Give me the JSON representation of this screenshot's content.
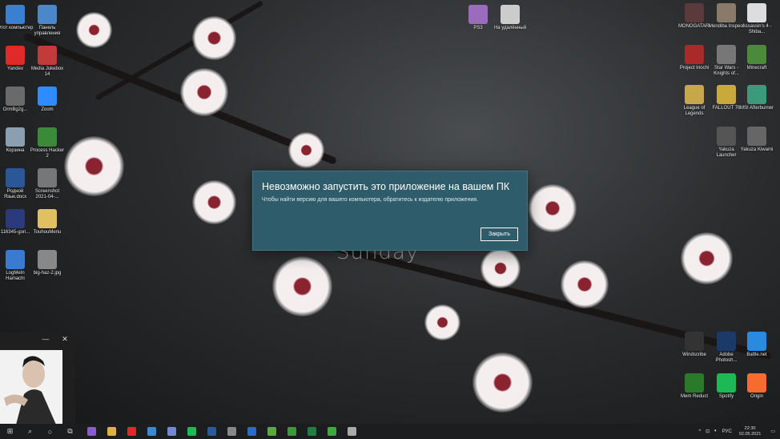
{
  "wallpaper": {
    "clock_text": "Sunday"
  },
  "desktop_icons_left": [
    {
      "label": "Этот компьютер",
      "icon": "computer-icon",
      "color": "#3b7fd1"
    },
    {
      "label": "Панель управления",
      "icon": "control-panel-icon",
      "color": "#4b88c9"
    },
    {
      "label": "Yandex",
      "icon": "yandex-browser-icon",
      "color": "#e02a2a"
    },
    {
      "label": "Media Jukebox 14",
      "icon": "media-jukebox-icon",
      "color": "#c23a3a"
    },
    {
      "label": "OrmBg2g...",
      "icon": "ormbg-icon",
      "color": "#6a6a6a"
    },
    {
      "label": "Zoom",
      "icon": "zoom-icon",
      "color": "#2d8cff"
    },
    {
      "label": "Корзина",
      "icon": "recycle-bin-icon",
      "color": "#8aa0b0"
    },
    {
      "label": "Process Hacker 2",
      "icon": "process-hacker-icon",
      "color": "#3a8a3a"
    },
    {
      "label": "Родной Язык.docx",
      "icon": "word-doc-icon",
      "color": "#2b5797"
    },
    {
      "label": "Screenshot 2021-04-...",
      "icon": "screenshot-file-icon",
      "color": "#777777"
    },
    {
      "label": "116345-gon...",
      "icon": "image-file-icon",
      "color": "#2a3a7a"
    },
    {
      "label": "TouhouMenu",
      "icon": "folder-icon",
      "color": "#e0c060"
    },
    {
      "label": "LogMeIn Hamachi",
      "icon": "hamachi-icon",
      "color": "#3a7ad0"
    },
    {
      "label": "big-haz-2.jpg",
      "icon": "jpg-file-icon",
      "color": "#888888"
    }
  ],
  "desktop_icons_top_center": [
    {
      "label": "PS3",
      "icon": "ps3-shortcut-icon",
      "color": "#9b6bc0"
    },
    {
      "label": "На удалённый",
      "icon": "text-file-icon",
      "color": "#cccccc"
    }
  ],
  "desktop_icons_right": [
    {
      "label": "MONOGATARI",
      "icon": "game-icon-1",
      "color": "#5a3a3a"
    },
    {
      "label": "Mendiba Inspect",
      "icon": "game-icon-2",
      "color": "#8a7a6a"
    },
    {
      "label": "Assassin's 4 - Shiba...",
      "icon": "game-icon-3",
      "color": "#ddd"
    },
    {
      "label": "Project Inochi",
      "icon": "game-icon-4",
      "color": "#aa2a2a"
    },
    {
      "label": "Star Wars - Knights of...",
      "icon": "star-wars-icon",
      "color": "#777"
    },
    {
      "label": "Minecraft",
      "icon": "minecraft-icon",
      "color": "#4a8a3a"
    },
    {
      "label": "League of Legends",
      "icon": "league-icon",
      "color": "#c8a74a"
    },
    {
      "label": "FALLOUT 76",
      "icon": "fallout-icon",
      "color": "#c9a93a"
    },
    {
      "label": "MSI Afterburner",
      "icon": "msi-icon",
      "color": "#3a9a7a"
    },
    {
      "label": "Yakuza Launcher",
      "icon": "yakuza-launcher-icon",
      "color": "#555"
    },
    {
      "label": "Yakuza Kiwami",
      "icon": "yakuza-kiwami-icon",
      "color": "#666"
    },
    {
      "label": "Windscribe",
      "icon": "windscribe-icon",
      "color": "#333"
    },
    {
      "label": "Adobe Photosh...",
      "icon": "photoshop-icon",
      "color": "#1b3a6a"
    },
    {
      "label": "Battle.net",
      "icon": "battlenet-icon",
      "color": "#2a8ae0"
    },
    {
      "label": "Mem Reduct",
      "icon": "mem-reduct-icon",
      "color": "#2a7a2a"
    },
    {
      "label": "Spotify",
      "icon": "spotify-icon",
      "color": "#1db954"
    },
    {
      "label": "Origin",
      "icon": "origin-icon",
      "color": "#f56c2d"
    }
  ],
  "dialog": {
    "title": "Невозможно запустить это приложение на вашем ПК",
    "message": "Чтобы найти версию для вашего компьютера, обратитесь к издателю приложения.",
    "close_button": "Закрыть",
    "bg_color": "#2f5c6b"
  },
  "mini_window": {
    "minimize": "—",
    "close": "✕"
  },
  "taskbar": {
    "items": [
      {
        "name": "start-button",
        "glyph": "⊞"
      },
      {
        "name": "search-icon",
        "glyph": "⌕"
      },
      {
        "name": "cortana-icon",
        "glyph": "○"
      },
      {
        "name": "task-view-icon",
        "glyph": "⧉"
      }
    ],
    "apps": [
      {
        "name": "app-purple",
        "color": "#8a5ad8"
      },
      {
        "name": "app-explorer",
        "color": "#e0b040"
      },
      {
        "name": "app-yandex",
        "color": "#e02a2a"
      },
      {
        "name": "app-steam",
        "color": "#3a8ad0"
      },
      {
        "name": "app-discord",
        "color": "#7289da"
      },
      {
        "name": "app-spotify",
        "color": "#1db954"
      },
      {
        "name": "app-photoshop",
        "color": "#2a5a9a"
      },
      {
        "name": "app-settings",
        "color": "#888888"
      },
      {
        "name": "app-edge",
        "color": "#2a6ad0"
      },
      {
        "name": "app-utorrent",
        "color": "#5aaa3a"
      },
      {
        "name": "app-memreduct",
        "color": "#3a9a3a"
      },
      {
        "name": "app-excel",
        "color": "#1e7e45"
      },
      {
        "name": "app-xbox",
        "color": "#3aaa3a"
      },
      {
        "name": "app-yakuza",
        "color": "#aaaaaa"
      }
    ],
    "tray": {
      "chevron": "^",
      "language": "РУС",
      "time": "22:30",
      "date": "02.05.2021",
      "notification": "▭"
    }
  }
}
